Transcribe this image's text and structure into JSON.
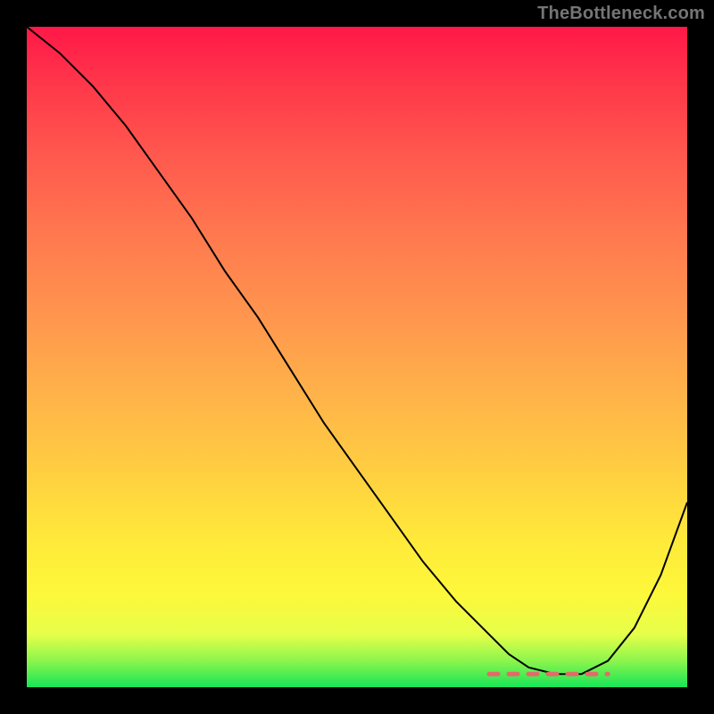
{
  "watermark": "TheBottleneck.com",
  "colors": {
    "page_bg": "#000000",
    "watermark_text": "#757575",
    "curve_stroke": "#000000",
    "dash_stroke": "#e46a6a",
    "gradient_stops": [
      "#ff1848",
      "#ff3b4a",
      "#ff5a4e",
      "#ff7a4f",
      "#ff964e",
      "#ffb349",
      "#ffd040",
      "#ffea3a",
      "#fdf83a",
      "#e6ff4a",
      "#8cf54c",
      "#17e558"
    ]
  },
  "chart_data": {
    "type": "line",
    "title": "",
    "xlabel": "",
    "ylabel": "",
    "xlim": [
      0,
      100
    ],
    "ylim": [
      0,
      100
    ],
    "grid": false,
    "legend": false,
    "series": [
      {
        "name": "bottleneck-curve",
        "x": [
          0,
          5,
          10,
          15,
          20,
          25,
          30,
          35,
          40,
          45,
          50,
          55,
          60,
          65,
          70,
          73,
          76,
          80,
          84,
          88,
          92,
          96,
          100
        ],
        "y": [
          100,
          96,
          91,
          85,
          78,
          71,
          63,
          56,
          48,
          40,
          33,
          26,
          19,
          13,
          8,
          5,
          3,
          2,
          2,
          4,
          9,
          17,
          28
        ]
      }
    ],
    "annotations": [
      {
        "name": "optimal-band-dash",
        "type": "segment",
        "x_range": [
          70,
          88
        ],
        "y": 2,
        "style": "dashed",
        "color": "#e46a6a"
      }
    ],
    "background_gradient": {
      "direction": "vertical",
      "meaning": "top=high bottleneck (red), bottom=low bottleneck (green)"
    }
  }
}
